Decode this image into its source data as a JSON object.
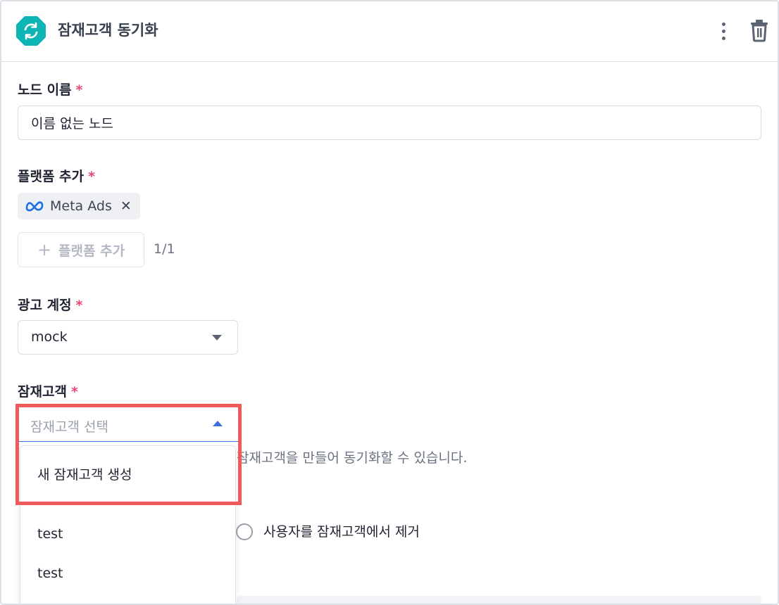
{
  "header": {
    "title": "잠재고객 동기화",
    "icon": "sync-icon",
    "icon_color": "#0fb5b5"
  },
  "fields": {
    "node_name": {
      "label": "노드 이름",
      "required_mark": "*",
      "value": "이름 없는 노드"
    },
    "platform": {
      "label": "플랫폼 추가",
      "required_mark": "*",
      "chip": {
        "label": "Meta Ads",
        "icon": "meta-logo-icon",
        "remove": "✕"
      },
      "add_button": {
        "label": "플랫폼 추가",
        "icon": "+"
      },
      "count": "1/1"
    },
    "ad_account": {
      "label": "광고 계정",
      "required_mark": "*",
      "value": "mock"
    },
    "audience": {
      "label": "잠재고객",
      "required_mark": "*",
      "placeholder": "잠재고객 선택",
      "helper_text": "잠재고객을 만들어 동기화할 수 있습니다.",
      "dropdown_options": [
        "새 잠재고객 생성",
        "test",
        "test"
      ]
    }
  },
  "action": {
    "radio_label": "사용자를 잠재고객에서 제거"
  },
  "colors": {
    "required": "#e8457a",
    "accent": "#3b6fe0",
    "highlight": "#f05a5a"
  }
}
